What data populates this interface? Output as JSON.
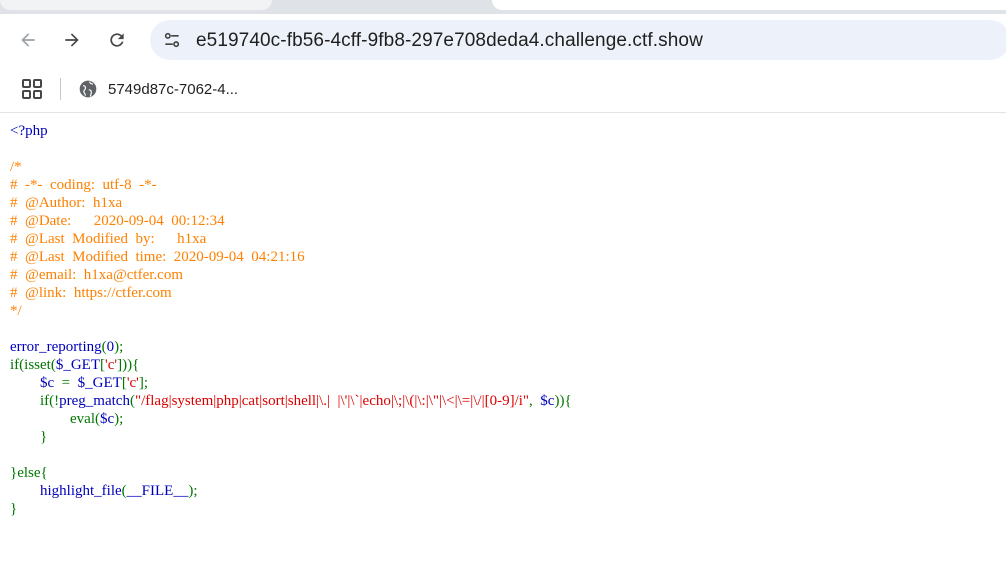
{
  "browser": {
    "url": "e519740c-fb56-4cff-9fb8-297e708deda4.challenge.ctf.show",
    "bookmark_label": "5749d87c-7062-4...",
    "icons": {
      "back": "arrow-left-icon",
      "forward": "arrow-right-icon",
      "reload": "reload-icon",
      "site_info": "tune-icon",
      "apps": "apps-grid-icon",
      "bookmark": "globe-icon"
    }
  },
  "colors": {
    "default": "#0000BB",
    "keyword": "#007700",
    "comment": "#FF8000",
    "string": "#DD0000"
  },
  "code": {
    "lines": [
      {
        "text": "<?php",
        "class": "c-default"
      },
      {
        "text": "",
        "class": "c-default"
      },
      {
        "text": "/*",
        "class": "c-comment"
      },
      {
        "text": "#  -*-  coding:  utf-8  -*-",
        "class": "c-comment"
      },
      {
        "text": "#  @Author:  h1xa",
        "class": "c-comment"
      },
      {
        "text": "#  @Date:      2020-09-04  00:12:34",
        "class": "c-comment"
      },
      {
        "text": "#  @Last  Modified  by:      h1xa",
        "class": "c-comment"
      },
      {
        "text": "#  @Last  Modified  time:  2020-09-04  04:21:16",
        "class": "c-comment"
      },
      {
        "text": "#  @email:  h1xa@ctfer.com",
        "class": "c-comment"
      },
      {
        "text": "#  @link:  https://ctfer.com",
        "class": "c-comment"
      },
      {
        "text": "*/",
        "class": "c-comment"
      },
      {
        "text": "",
        "class": "c-default"
      },
      {
        "segments": [
          {
            "t": "error_reporting",
            "c": "c-default"
          },
          {
            "t": "(",
            "c": "c-keyword"
          },
          {
            "t": "0",
            "c": "c-default"
          },
          {
            "t": ");",
            "c": "c-keyword"
          }
        ]
      },
      {
        "segments": [
          {
            "t": "if(isset(",
            "c": "c-keyword"
          },
          {
            "t": "$_GET",
            "c": "c-default"
          },
          {
            "t": "[",
            "c": "c-keyword"
          },
          {
            "t": "'c'",
            "c": "c-string"
          },
          {
            "t": "])){",
            "c": "c-keyword"
          }
        ]
      },
      {
        "segments": [
          {
            "t": "        ",
            "c": "c-keyword"
          },
          {
            "t": "$c  ",
            "c": "c-default"
          },
          {
            "t": "=  ",
            "c": "c-keyword"
          },
          {
            "t": "$_GET",
            "c": "c-default"
          },
          {
            "t": "[",
            "c": "c-keyword"
          },
          {
            "t": "'c'",
            "c": "c-string"
          },
          {
            "t": "];",
            "c": "c-keyword"
          }
        ]
      },
      {
        "segments": [
          {
            "t": "        if(!",
            "c": "c-keyword"
          },
          {
            "t": "preg_match",
            "c": "c-default"
          },
          {
            "t": "(",
            "c": "c-keyword"
          },
          {
            "t": "\"/flag|system|php|cat|sort|shell|\\.|  |\\'|\\`|echo|\\;|\\(|\\:|\\\"|\\<|\\=|\\/|[0-9]/i\"",
            "c": "c-string"
          },
          {
            "t": ",  ",
            "c": "c-keyword"
          },
          {
            "t": "$c",
            "c": "c-default"
          },
          {
            "t": ")){",
            "c": "c-keyword"
          }
        ]
      },
      {
        "segments": [
          {
            "t": "                eval(",
            "c": "c-keyword"
          },
          {
            "t": "$c",
            "c": "c-default"
          },
          {
            "t": ");",
            "c": "c-keyword"
          }
        ]
      },
      {
        "segments": [
          {
            "t": "        }",
            "c": "c-keyword"
          }
        ]
      },
      {
        "text": "",
        "class": "c-default"
      },
      {
        "segments": [
          {
            "t": "}else{",
            "c": "c-keyword"
          }
        ]
      },
      {
        "segments": [
          {
            "t": "        ",
            "c": "c-keyword"
          },
          {
            "t": "highlight_file",
            "c": "c-default"
          },
          {
            "t": "(",
            "c": "c-keyword"
          },
          {
            "t": "__FILE__",
            "c": "c-default"
          },
          {
            "t": ");",
            "c": "c-keyword"
          }
        ]
      },
      {
        "segments": [
          {
            "t": "}",
            "c": "c-keyword"
          }
        ]
      }
    ]
  }
}
